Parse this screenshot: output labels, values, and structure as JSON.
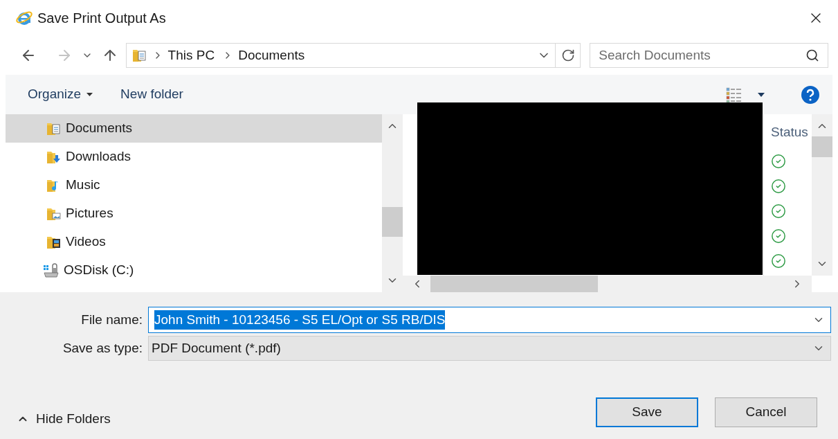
{
  "window": {
    "title": "Save Print Output As"
  },
  "navigation": {
    "back": {
      "disabled": false
    },
    "forward": {
      "disabled": true
    }
  },
  "address": {
    "path": [
      "This PC",
      "Documents"
    ]
  },
  "search": {
    "placeholder": "Search Documents"
  },
  "toolbar": {
    "buttons": [
      {
        "label": "Organize",
        "kind": "menu"
      },
      {
        "label": "New folder",
        "kind": "plain"
      }
    ]
  },
  "sidebar": {
    "items": [
      {
        "label": "Documents",
        "kind": "documents",
        "selected": true
      },
      {
        "label": "Downloads",
        "kind": "downloads",
        "selected": false
      },
      {
        "label": "Music",
        "kind": "music",
        "selected": false
      },
      {
        "label": "Pictures",
        "kind": "pictures",
        "selected": false
      },
      {
        "label": "Videos",
        "kind": "videos",
        "selected": false
      },
      {
        "label": "OSDisk (C:)",
        "kind": "drive",
        "selected": false
      }
    ]
  },
  "file_list": {
    "columns": [
      {
        "label": "Status"
      }
    ],
    "rows": [
      {
        "complete": true
      },
      {
        "complete": true
      },
      {
        "complete": true
      },
      {
        "complete": true
      },
      {
        "complete": true
      }
    ]
  },
  "form": {
    "file_name": {
      "label": "File name:",
      "value": "John Smith - 10123456 - S5 EL/Opt or S5 RB/DIS",
      "selected": true
    },
    "save_as_type": {
      "label": "Save as type:",
      "value": "PDF Document (*.pdf)"
    }
  },
  "hide_folders": "Hide Folders",
  "buttons": [
    {
      "label": "Save",
      "default": true
    },
    {
      "label": "Cancel",
      "default": false
    }
  ]
}
